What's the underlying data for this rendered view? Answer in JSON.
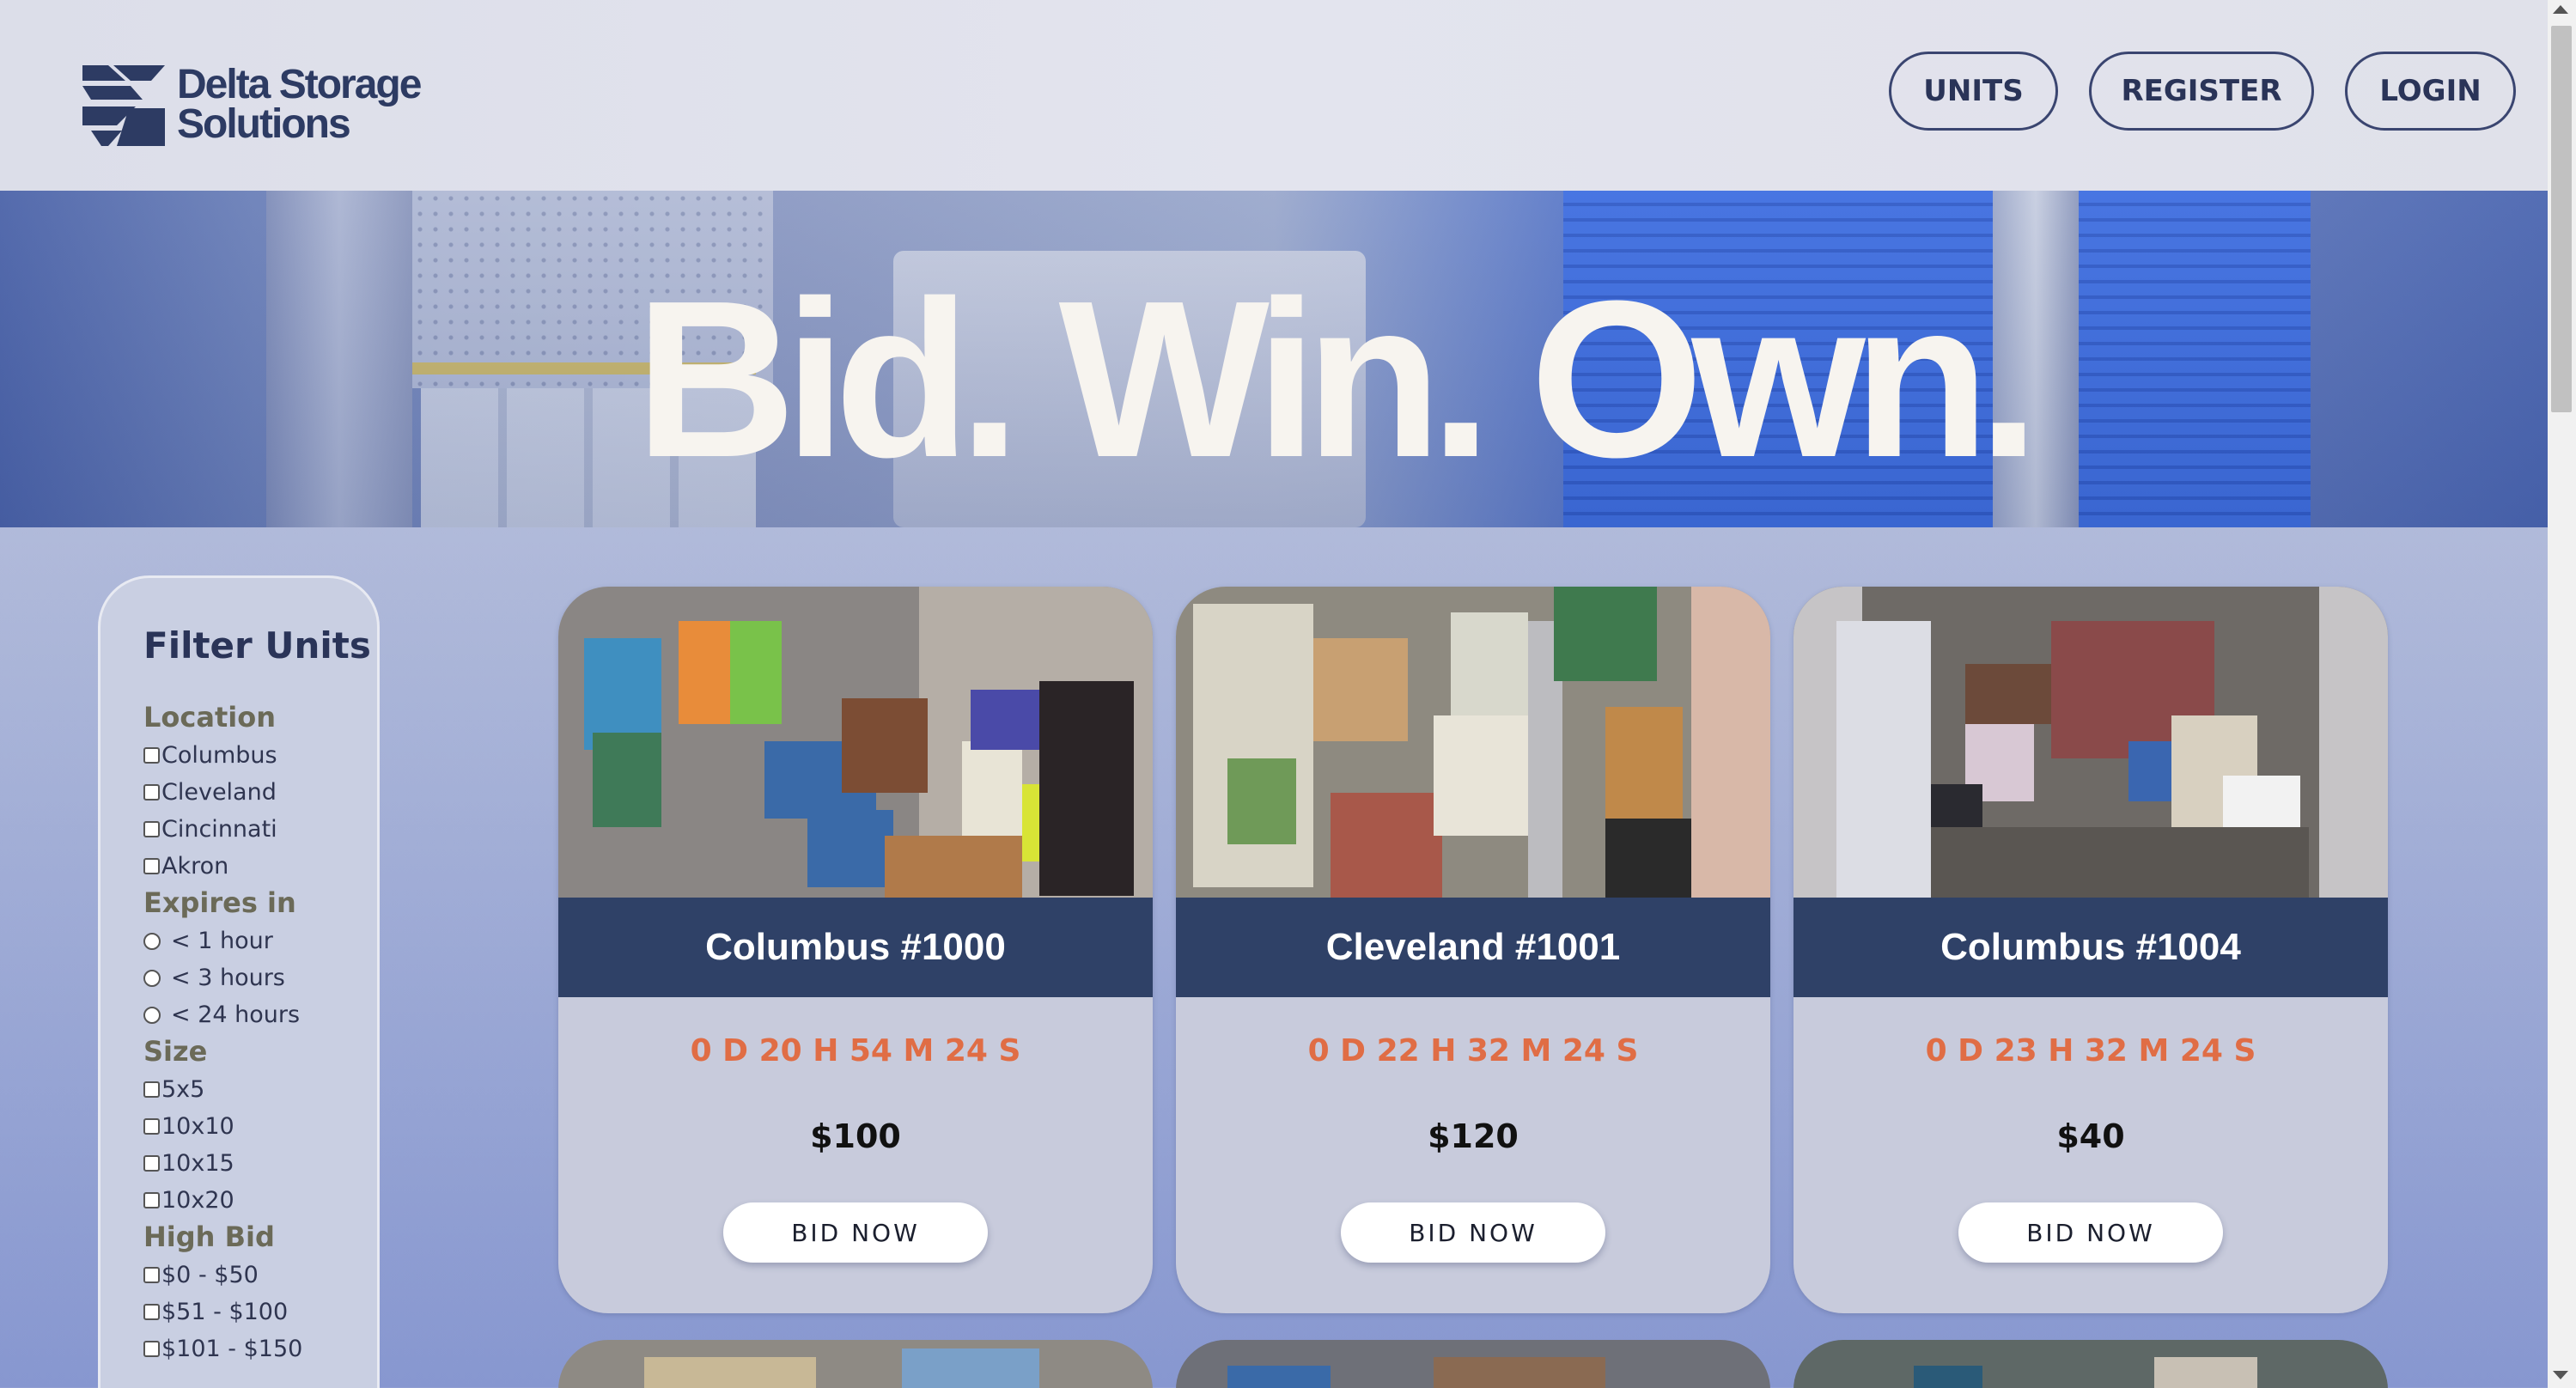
{
  "brand": {
    "line1": "Delta Storage",
    "line2": "Solutions"
  },
  "nav": {
    "units": "UNITS",
    "register": "REGISTER",
    "login": "LOGIN"
  },
  "hero": {
    "title": "Bid. Win. Own."
  },
  "filter": {
    "title": "Filter Units",
    "location": {
      "label": "Location",
      "options": [
        "Columbus",
        "Cleveland",
        "Cincinnati",
        "Akron"
      ]
    },
    "expires": {
      "label": "Expires in",
      "options": [
        "< 1 hour",
        "< 3 hours",
        "< 24 hours"
      ]
    },
    "size": {
      "label": "Size",
      "options": [
        "5x5",
        "10x10",
        "10x15",
        "10x20"
      ]
    },
    "high_bid": {
      "label": "High Bid",
      "options": [
        "$0 - $50",
        "$51 - $100",
        "$101 - $150"
      ]
    }
  },
  "cards": [
    {
      "name": "Columbus #1000",
      "countdown": "0 D 20 H 54 M 24 S",
      "price": "$100",
      "button": "BID NOW"
    },
    {
      "name": "Cleveland #1001",
      "countdown": "0 D 22 H 32 M 24 S",
      "price": "$120",
      "button": "BID NOW"
    },
    {
      "name": "Columbus #1004",
      "countdown": "0 D 23 H 32 M 24 S",
      "price": "$40",
      "button": "BID NOW"
    }
  ],
  "colors": {
    "navy": "#2f4167",
    "accent": "#e06d45",
    "text": "#2a3458"
  }
}
